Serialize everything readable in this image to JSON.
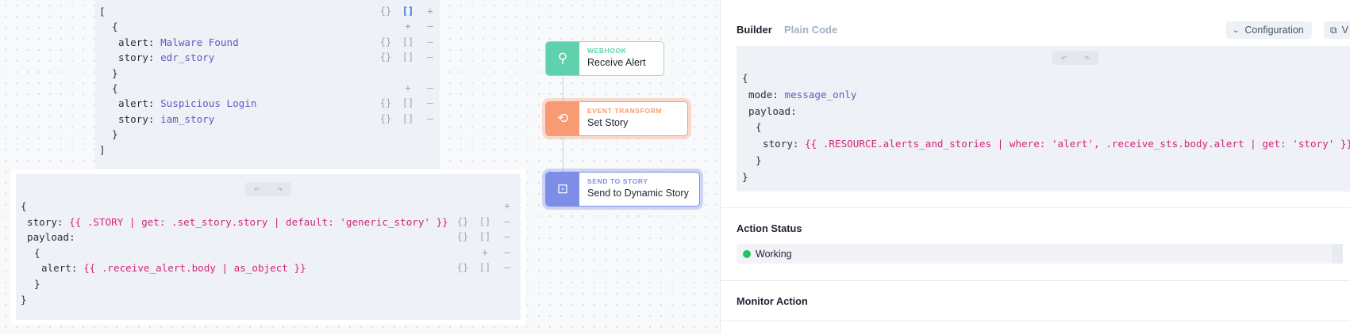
{
  "top_editor": {
    "lines": [
      {
        "key": "[",
        "value": "",
        "kind": "plain",
        "controls": [
          "{}",
          "[]",
          "+"
        ],
        "active": "[]"
      },
      {
        "key": "{",
        "value": "",
        "kind": "plain",
        "controls": [
          "",
          "+",
          "—"
        ]
      },
      {
        "key": "alert:",
        "value": "Malware Found",
        "kind": "val",
        "controls": [
          "{}",
          "[]",
          "—"
        ]
      },
      {
        "key": "story:",
        "value": "edr_story",
        "kind": "val",
        "controls": [
          "{}",
          "[]",
          "—"
        ]
      },
      {
        "key": "}",
        "value": "",
        "kind": "plain",
        "controls": []
      },
      {
        "key": "{",
        "value": "",
        "kind": "plain",
        "controls": [
          "",
          "+",
          "—"
        ]
      },
      {
        "key": "alert:",
        "value": "Suspicious Login",
        "kind": "val",
        "controls": [
          "{}",
          "[]",
          "—"
        ]
      },
      {
        "key": "story:",
        "value": "iam_story",
        "kind": "val",
        "controls": [
          "{}",
          "[]",
          "—"
        ]
      },
      {
        "key": "}",
        "value": "",
        "kind": "plain",
        "controls": []
      },
      {
        "key": "]",
        "value": "",
        "kind": "plain",
        "controls": []
      }
    ]
  },
  "bottom_editor": {
    "undo_icon": "undo-icon",
    "redo_icon": "redo-icon",
    "lines": [
      {
        "key": "{",
        "value": "",
        "kind": "plain",
        "controls": [
          "",
          "",
          "+"
        ]
      },
      {
        "key": "story:",
        "value": "{{ .STORY | get: .set_story.story | default: 'generic_story' }}",
        "kind": "expr",
        "controls": [
          "{}",
          "[]",
          "—"
        ]
      },
      {
        "key": "payload:",
        "value": "",
        "kind": "plain",
        "controls": [
          "{}",
          "[]",
          "—"
        ]
      },
      {
        "key": "{",
        "value": "",
        "kind": "plain",
        "controls": [
          "",
          "+",
          "—"
        ]
      },
      {
        "key": "alert:",
        "value": "{{ .receive_alert.body | as_object }}",
        "kind": "expr",
        "controls": [
          "{}",
          "[]",
          "—"
        ]
      },
      {
        "key": "}",
        "value": "",
        "kind": "plain",
        "controls": []
      },
      {
        "key": "}",
        "value": "",
        "kind": "plain",
        "controls": []
      }
    ]
  },
  "flow": {
    "nodes": [
      {
        "type": "WEBHOOK",
        "name": "Receive Alert",
        "icon": "webhook-icon",
        "color": "#5fd1ad",
        "border": "#8fe0c6",
        "selected": false
      },
      {
        "type": "EVENT TRANSFORM",
        "name": "Set Story",
        "icon": "transform-icon",
        "color": "#f89a73",
        "border": "#f89a73",
        "selected": true
      },
      {
        "type": "SEND TO STORY",
        "name": "Send to Dynamic Story",
        "icon": "send-to-story-icon",
        "color": "#7c8ee6",
        "border": "#7c8ee6",
        "selected": true
      }
    ]
  },
  "panel": {
    "tabs": {
      "builder": "Builder",
      "plain_code": "Plain Code"
    },
    "configuration_label": "Configuration",
    "external_label": "V",
    "editor": {
      "lines": [
        {
          "key": "{",
          "value": "",
          "kind": "plain"
        },
        {
          "key": "mode:",
          "value": "message_only",
          "kind": "val"
        },
        {
          "key": "payload:",
          "value": "",
          "kind": "plain"
        },
        {
          "key": "{",
          "value": "",
          "kind": "plain"
        },
        {
          "key": "story:",
          "value": "{{ .RESOURCE.alerts_and_stories | where: 'alert', .receive_sts.body.alert | get: 'story' }}",
          "kind": "expr"
        },
        {
          "key": "}",
          "value": "",
          "kind": "plain"
        },
        {
          "key": "}",
          "value": "",
          "kind": "plain"
        }
      ]
    },
    "action_status": {
      "title": "Action Status",
      "value": "Working",
      "color": "#22c55e"
    },
    "monitor": {
      "title": "Monitor Action"
    }
  }
}
